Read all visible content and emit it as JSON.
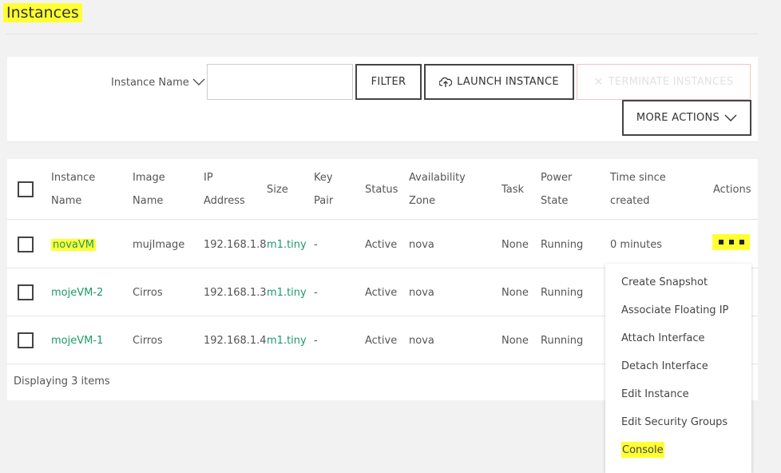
{
  "page": {
    "title": "Instances"
  },
  "toolbar": {
    "filter_field": "Instance Name",
    "filter_value": "",
    "filter_label": "FILTER",
    "launch_label": "LAUNCH INSTANCE",
    "terminate_label": "TERMINATE INSTANCES",
    "more_label": "MORE ACTIONS"
  },
  "table": {
    "headers": {
      "instance_name": [
        "Instance",
        "Name"
      ],
      "image_name": [
        "Image",
        "Name"
      ],
      "ip": [
        "IP",
        "Address"
      ],
      "size": "Size",
      "key_pair": [
        "Key",
        "Pair"
      ],
      "status": "Status",
      "zone": [
        "Availability",
        "Zone"
      ],
      "task": "Task",
      "power": [
        "Power",
        "State"
      ],
      "time": [
        "Time since",
        "created"
      ],
      "actions": "Actions"
    },
    "rows": [
      {
        "name": "novaVM",
        "image": "mujImage",
        "ip": "192.168.1.8",
        "size": "m1.tiny",
        "key_pair": "-",
        "status": "Active",
        "zone": "nova",
        "task": "None",
        "power": "Running",
        "time": "0 minutes"
      },
      {
        "name": "mojeVM-2",
        "image": "Cirros",
        "ip": "192.168.1.3",
        "size": "m1.tiny",
        "key_pair": "-",
        "status": "Active",
        "zone": "nova",
        "task": "None",
        "power": "Running",
        "time": ""
      },
      {
        "name": "mojeVM-1",
        "image": "Cirros",
        "ip": "192.168.1.4",
        "size": "m1.tiny",
        "key_pair": "-",
        "status": "Active",
        "zone": "nova",
        "task": "None",
        "power": "Running",
        "time": ""
      }
    ],
    "footer": "Displaying 3 items"
  },
  "actions_menu": {
    "items": [
      "Create Snapshot",
      "Associate Floating IP",
      "Attach Interface",
      "Detach Interface",
      "Edit Instance",
      "Edit Security Groups",
      "Console"
    ]
  },
  "colors": {
    "accent_green": "#1e9a6a",
    "highlight": "#ffff33",
    "terminate_border": "#f3c4c4"
  }
}
